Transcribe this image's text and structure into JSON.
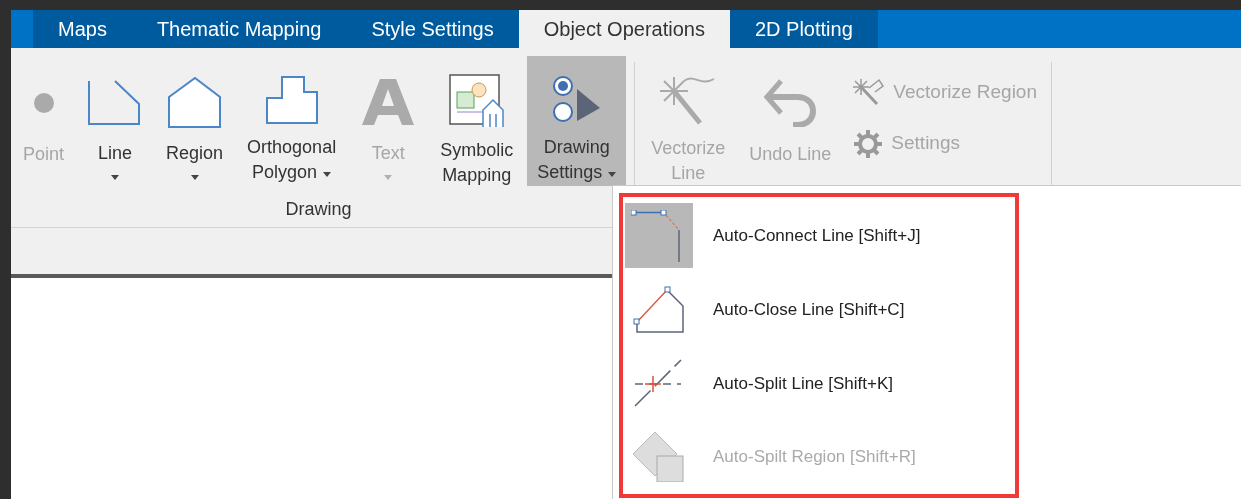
{
  "tabs": [
    {
      "label": "Maps",
      "selected": false
    },
    {
      "label": "Thematic Mapping",
      "selected": false
    },
    {
      "label": "Style Settings",
      "selected": false
    },
    {
      "label": "Object Operations",
      "selected": true
    },
    {
      "label": "2D Plotting",
      "selected": false
    }
  ],
  "ribbon": {
    "groups": [
      {
        "label": "Drawing",
        "buttons": [
          {
            "lines": [
              "Point"
            ],
            "dropdown": false,
            "disabled": true,
            "active": false
          },
          {
            "lines": [
              "Line"
            ],
            "dropdown": true,
            "disabled": false,
            "active": false
          },
          {
            "lines": [
              "Region"
            ],
            "dropdown": true,
            "disabled": false,
            "active": false
          },
          {
            "lines": [
              "Orthogonal",
              "Polygon"
            ],
            "dropdown": true,
            "disabled": false,
            "active": false
          },
          {
            "lines": [
              "Text"
            ],
            "dropdown": true,
            "disabled": true,
            "active": false
          },
          {
            "lines": [
              "Symbolic",
              "Mapping"
            ],
            "dropdown": false,
            "disabled": false,
            "active": false
          },
          {
            "lines": [
              "Drawing",
              "Settings"
            ],
            "dropdown": true,
            "disabled": false,
            "active": true
          }
        ]
      },
      {
        "buttons": [
          {
            "lines": [
              "Vectorize",
              "Line"
            ],
            "dropdown": false,
            "disabled": true,
            "active": false
          },
          {
            "lines": [
              "Undo Line"
            ],
            "dropdown": false,
            "disabled": true,
            "active": false
          }
        ],
        "small_buttons": [
          {
            "label": "Vectorize Region",
            "disabled": true
          },
          {
            "label": "Settings",
            "disabled": true
          }
        ]
      }
    ]
  },
  "menu": {
    "items": [
      {
        "label": "Auto-Connect Line [Shift+J]",
        "selected": true,
        "disabled": false
      },
      {
        "label": "Auto-Close Line [Shift+C]",
        "selected": false,
        "disabled": false
      },
      {
        "label": "Auto-Split Line [Shift+K]",
        "selected": false,
        "disabled": false
      },
      {
        "label": "Auto-Spilt Region [Shift+R]",
        "selected": false,
        "disabled": true
      }
    ]
  }
}
